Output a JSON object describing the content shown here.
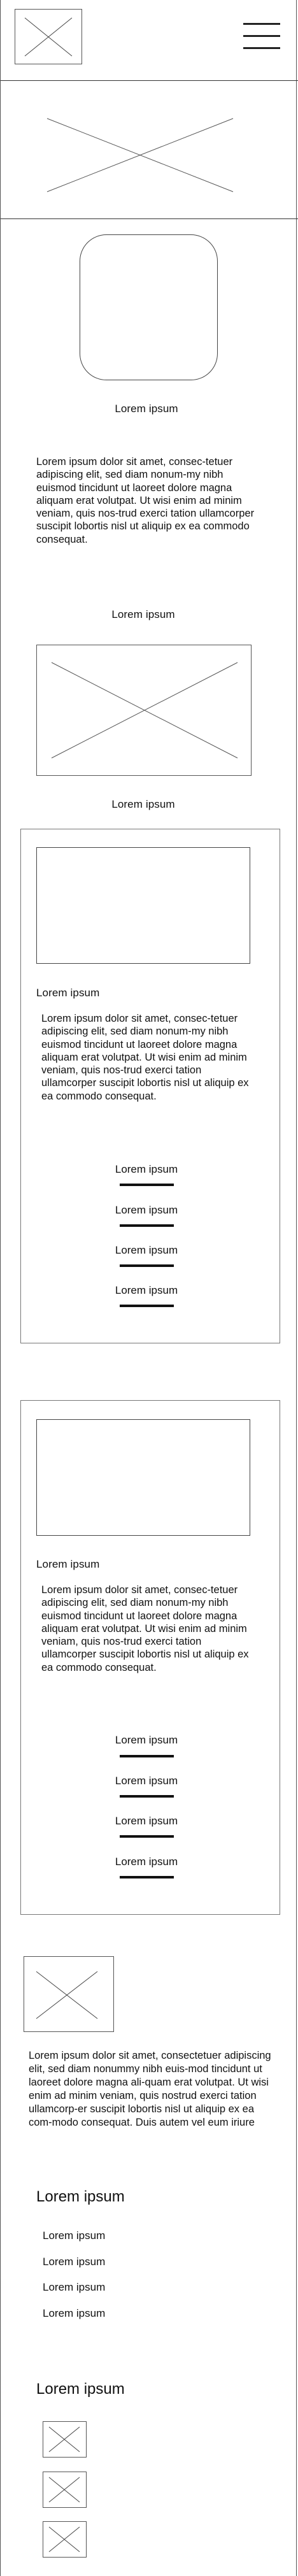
{
  "header": {
    "logo_icon": "image-placeholder-icon",
    "menu_icon": "hamburger-menu-icon"
  },
  "hero": {
    "image_icon": "image-placeholder-icon"
  },
  "profile": {
    "avatar_icon": "rounded-square-avatar",
    "title": "Lorem ipsum",
    "body": "Lorem ipsum dolor sit amet, consec-tetuer adipiscing elit, sed diam nonum-my nibh euismod tincidunt ut laoreet dolore magna aliquam erat volutpat. Ut wisi enim ad minim veniam, quis nos-trud exerci tation ullamcorper suscipit lobortis nisl ut aliquip ex ea commodo consequat.",
    "subtitle": "Lorem ipsum"
  },
  "feature": {
    "image_icon": "image-placeholder-icon",
    "caption": "Lorem ipsum"
  },
  "cards": [
    {
      "title": "Lorem ipsum",
      "body": "Lorem ipsum dolor sit amet, consec-tetuer adipiscing elit, sed diam nonum-my nibh euismod tincidunt ut laoreet dolore magna aliquam erat volutpat. Ut wisi enim ad minim veniam, quis nos-trud exerci tation ullamcorper suscipit lobortis nisl ut aliquip ex ea commodo consequat.",
      "links": [
        "Lorem ipsum",
        "Lorem ipsum",
        "Lorem ipsum",
        "Lorem ipsum"
      ]
    },
    {
      "title": "Lorem ipsum",
      "body": "Lorem ipsum dolor sit amet, consec-tetuer adipiscing elit, sed diam nonum-my nibh euismod tincidunt ut laoreet dolore magna aliquam erat volutpat. Ut wisi enim ad minim veniam, quis nos-trud exerci tation ullamcorper suscipit lobortis nisl ut aliquip ex ea commodo consequat.",
      "links": [
        "Lorem ipsum",
        "Lorem ipsum",
        "Lorem ipsum",
        "Lorem ipsum"
      ]
    }
  ],
  "footer_block": {
    "image_icon": "image-placeholder-icon",
    "body": "Lorem ipsum dolor sit amet, consectetuer adipiscing elit, sed diam nonummy nibh euis-mod tincidunt ut laoreet dolore magna ali-quam erat volutpat. Ut wisi enim ad minim veniam, quis nostrud exerci tation ullamcorp-er suscipit lobortis nisl ut aliquip ex ea com-modo consequat. Duis autem vel eum iriure",
    "list_heading": "Lorem ipsum",
    "list_items": [
      "Lorem ipsum",
      "Lorem ipsum",
      "Lorem ipsum",
      "Lorem ipsum"
    ],
    "icons_heading": "Lorem ipsum",
    "small_icons": [
      "image-placeholder-icon",
      "image-placeholder-icon",
      "image-placeholder-icon"
    ]
  }
}
